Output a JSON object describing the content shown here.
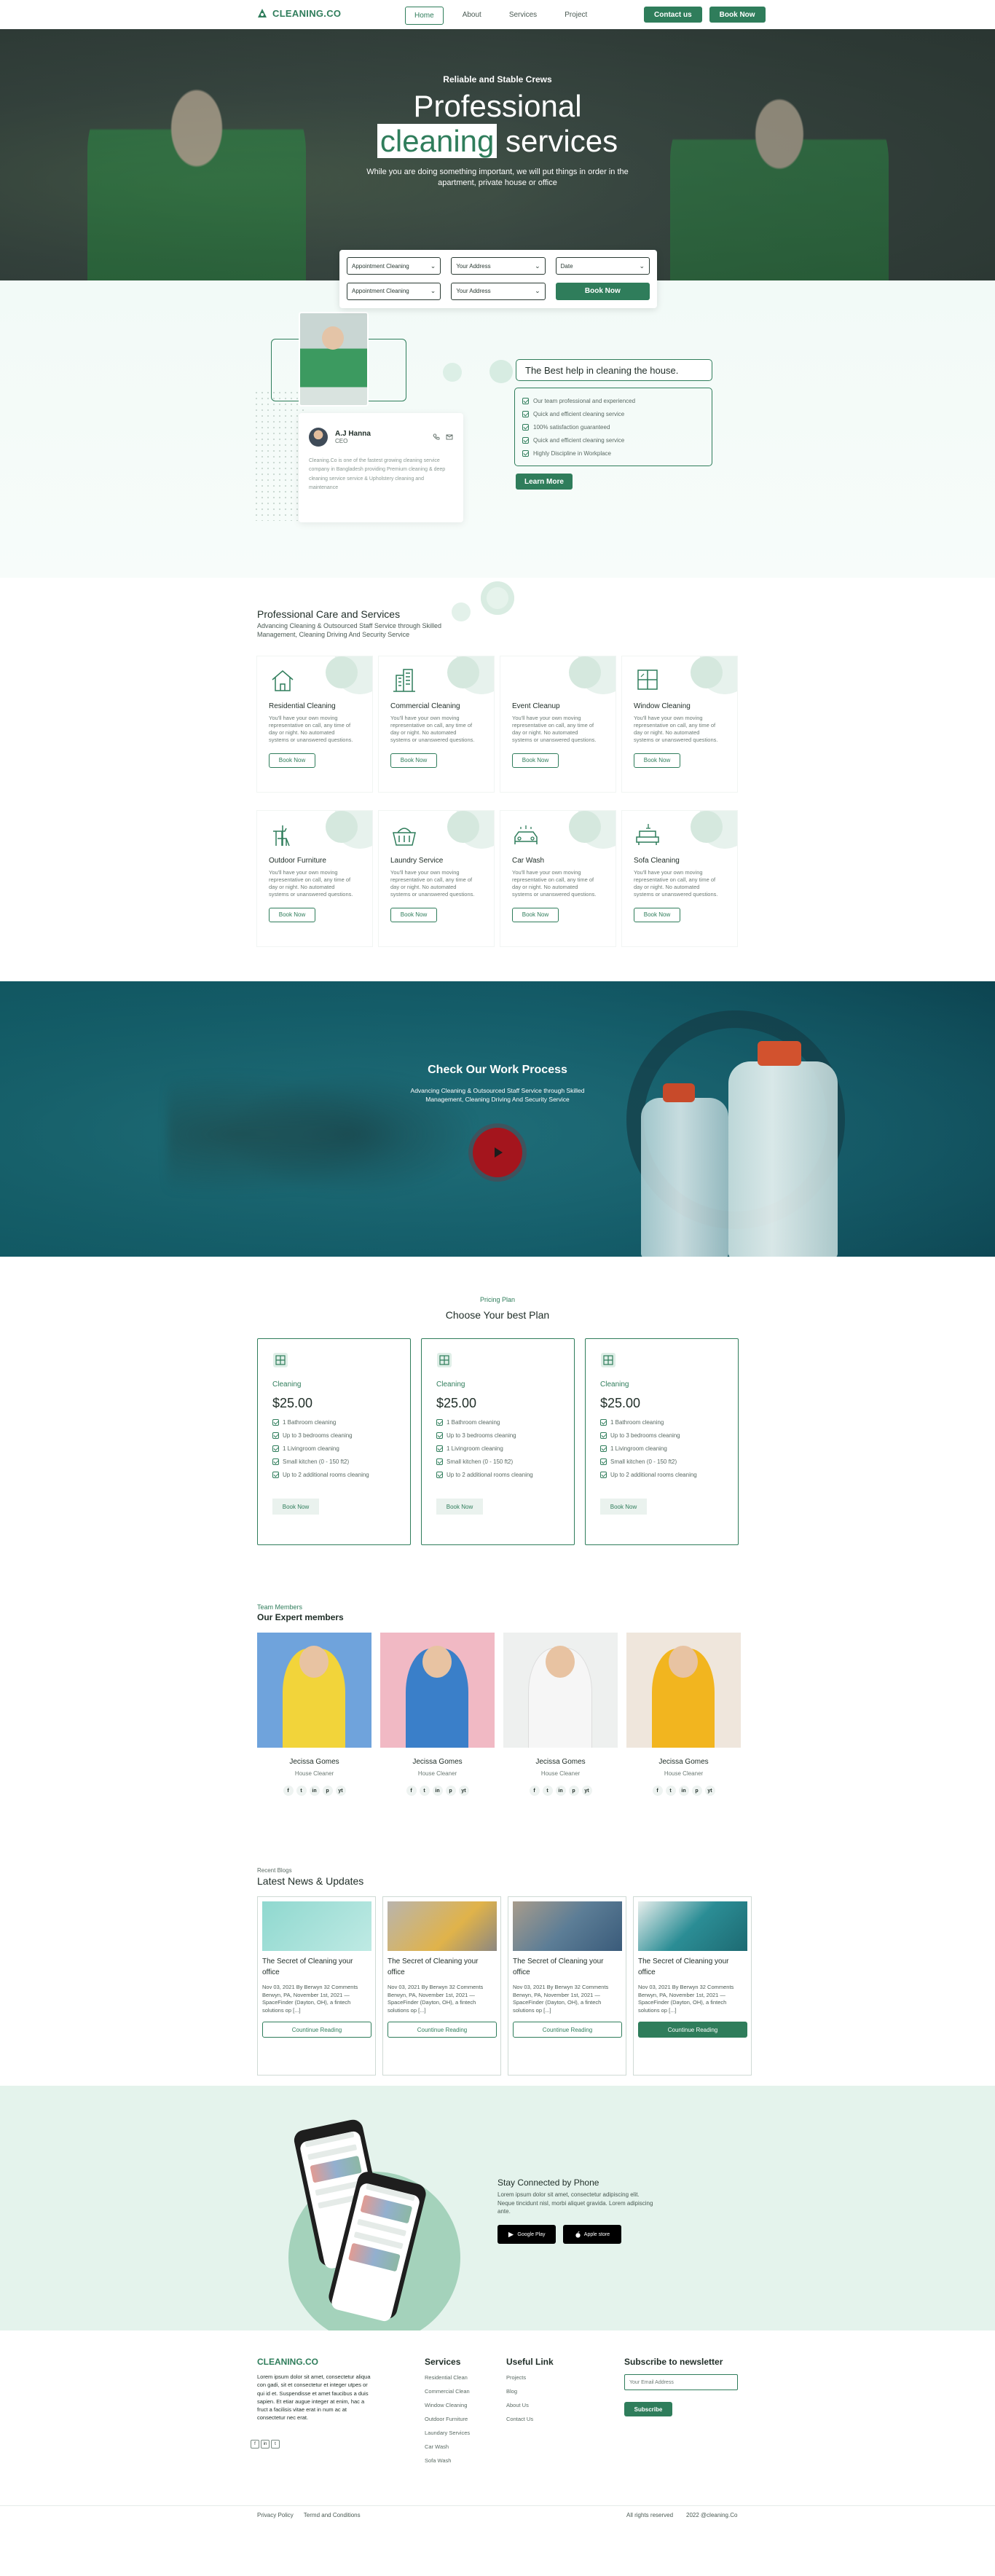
{
  "brand": {
    "name": "CLEANING.CO",
    "color": "#2f7d5b"
  },
  "nav": {
    "items": [
      "Home",
      "About",
      "Services",
      "Project"
    ],
    "active": "Home",
    "contact_label": "Contact us",
    "book_label": "Book Now"
  },
  "hero": {
    "eyebrow": "Reliable and Stable Crews",
    "title_line1": "Professional",
    "title_highlight": "cleaning",
    "title_rest": " services",
    "subtitle": "While you are doing something important, we will put things in order in the apartment, private house or office"
  },
  "booking": {
    "field1": "Appointment Cleaning",
    "field2": "Your Address",
    "field3": "Date",
    "field4": "Appointment Cleaning",
    "field5": "Your Address",
    "button": "Book Now"
  },
  "about": {
    "name": "A.J Hanna",
    "role": "CEO",
    "bio": "Cleaning.Co is one of the fastest growing cleaning service company in Bangladesh providing Premium cleaning & deep cleaning service service & Upholstery cleaning and maintenance",
    "headline": "The Best help in cleaning the house.",
    "points": [
      "Our team professional and experienced",
      "Quick and efficient cleaning service",
      "100% satisfaction guaranteed",
      "Quick and efficient cleaning service",
      "Highly Discipline in Workplace"
    ],
    "cta": "Learn More"
  },
  "services": {
    "title": "Professional Care and Services",
    "subtitle": "Advancing Cleaning & Outsourced Staff Service through Skilled Management, Cleaning Driving And Security Service",
    "desc": "You'll have your own moving representative on call, any time of day or night. No automated systems or unanswered questions.",
    "button": "Book Now",
    "items": [
      {
        "title": "Residential Cleaning",
        "icon": "house-icon"
      },
      {
        "title": "Commercial Cleaning",
        "icon": "building-icon"
      },
      {
        "title": "Event Cleanup",
        "icon": "event-icon"
      },
      {
        "title": "Window Cleaning",
        "icon": "window-icon"
      },
      {
        "title": "Outdoor Furniture",
        "icon": "furniture-icon"
      },
      {
        "title": "Laundry Service",
        "icon": "laundry-basket-icon"
      },
      {
        "title": "Car Wash",
        "icon": "car-wash-icon"
      },
      {
        "title": "Sofa Cleaning",
        "icon": "sofa-icon"
      }
    ]
  },
  "video": {
    "title": "Check Our Work Process",
    "subtitle": "Advancing Cleaning & Outsourced Staff Service through Skilled Management, Cleaning Driving And Security Service"
  },
  "pricing": {
    "eyebrow": "Pricing Plan",
    "title": "Choose Your best Plan",
    "plans": [
      {
        "name": "Cleaning",
        "price": "$25.00",
        "features": [
          "1 Bathroom cleaning",
          "Up to 3 bedrooms cleaning",
          "1 Livingroom cleaning",
          "Small kitchen (0 - 150 ft2)",
          "Up to 2 additional rooms cleaning"
        ],
        "button": "Book Now"
      },
      {
        "name": "Cleaning",
        "price": "$25.00",
        "features": [
          "1 Bathroom cleaning",
          "Up to 3 bedrooms cleaning",
          "1 Livingroom cleaning",
          "Small kitchen (0 - 150 ft2)",
          "Up to 2 additional rooms cleaning"
        ],
        "button": "Book Now"
      },
      {
        "name": "Cleaning",
        "price": "$25.00",
        "features": [
          "1 Bathroom cleaning",
          "Up to 3 bedrooms cleaning",
          "1 Livingroom cleaning",
          "Small kitchen (0 - 150 ft2)",
          "Up to 2 additional rooms cleaning"
        ],
        "button": "Book Now"
      }
    ]
  },
  "team": {
    "eyebrow": "Team Members",
    "title": "Our Expert members",
    "members": [
      {
        "name": "Jecissa Gomes",
        "role": "House Cleaner",
        "bg": "#6fa3dc",
        "fig": "#f2d43a"
      },
      {
        "name": "Jecissa Gomes",
        "role": "House Cleaner",
        "bg": "#f1b9c4",
        "fig": "#3a7fc9"
      },
      {
        "name": "Jecissa Gomes",
        "role": "House Cleaner",
        "bg": "#eef0ef",
        "fig": "#f6f6f6"
      },
      {
        "name": "Jecissa Gomes",
        "role": "House Cleaner",
        "bg": "#efe6dc",
        "fig": "#f2b51f"
      }
    ],
    "socials": [
      "f",
      "t",
      "in",
      "p",
      "yt"
    ]
  },
  "blog": {
    "eyebrow": "Recent Blogs",
    "title": "Latest News & Updates",
    "posts": [
      {
        "title": "The Secret of Cleaning your office",
        "meta": "Nov 03, 2021 By Berwyn 32 Comments",
        "excerpt": "Berwyn, PA, November 1st, 2021 — SpaceFinder (Dayton, OH), a fintech solutions op [...]",
        "button": "Countinue Reading",
        "thumb": "#8fd8cf"
      },
      {
        "title": "The Secret of Cleaning your office",
        "meta": "Nov 03, 2021 By Berwyn 32 Comments",
        "excerpt": "Berwyn, PA, November 1st, 2021 — SpaceFinder (Dayton, OH), a fintech solutions op [...]",
        "button": "Countinue Reading",
        "thumb": "#b9b4ad"
      },
      {
        "title": "The Secret of Cleaning your office",
        "meta": "Nov 03, 2021 By Berwyn 32 Comments",
        "excerpt": "Berwyn, PA, November 1st, 2021 — SpaceFinder (Dayton, OH), a fintech solutions op [...]",
        "button": "Countinue Reading",
        "thumb": "#5c7d96"
      },
      {
        "title": "The Secret of Cleaning your office",
        "meta": "Nov 03, 2021 By Berwyn 32 Comments",
        "excerpt": "Berwyn, PA, November 1st, 2021 — SpaceFinder (Dayton, OH), a fintech solutions op [...]",
        "button": "Countinue Reading",
        "thumb": "#2b8d95"
      }
    ]
  },
  "app": {
    "title": "Stay Connected by Phone",
    "text": "Lorem ipsum dolor sit amet, consectetur adipiscing elit. Neque tincidunt nisl, morbi aliquet gravida. Lorem adipiscing ante.",
    "google": "Google Play",
    "apple": "Apple store"
  },
  "footer": {
    "desc": "Lorem ipsum dolor sit amet, consectetur aliqua con gadi, sit et consectetur et integer utpes or qui id et. Suspendisse et amet faucibus a duis sapien. Et etiar augue integer at enim, hac a fruct a facilisis vitae erat in num ac at consectetur nec erat.",
    "services_title": "Services",
    "services": [
      "Residential Clean",
      "Commercial Clean",
      "Window Cleaning",
      "Outdoor Furniture",
      "Laundary Services",
      "Car Wash",
      "Sofa Wash"
    ],
    "useful_title": "Useful Link",
    "useful": [
      "Projects",
      "Blog",
      "About Us",
      "Contact Us"
    ],
    "newsletter_title": "Subscribe to newsletter",
    "email_placeholder": "Your Email Address",
    "subscribe": "Subscribe",
    "privacy": "Privacy Policy",
    "terms": "Termd and Conditions",
    "rights": "All rights reserved",
    "copyright": "2022 @cleaning.Co"
  }
}
